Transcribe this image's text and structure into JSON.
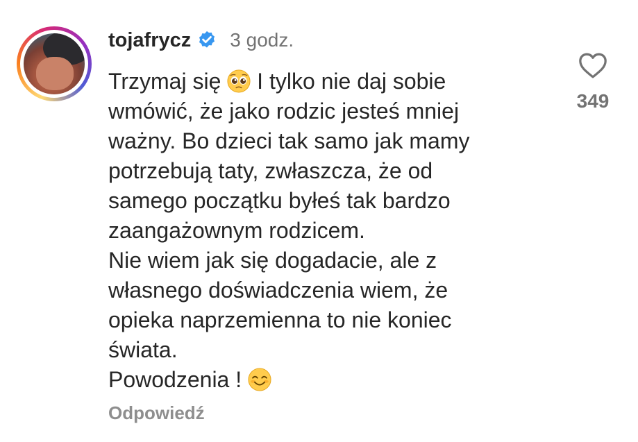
{
  "comment": {
    "username": "tojafrycz",
    "verified_icon": "verified-badge-icon",
    "timestamp": "3 godz.",
    "lines": [
      {
        "before": "Trzymaj się ",
        "emoji": "pleading-face",
        "after": " I tylko nie daj sobie"
      },
      {
        "text": "wmówić, że jako rodzic jesteś mniej"
      },
      {
        "text": "ważny. Bo dzieci tak samo jak mamy"
      },
      {
        "text": "potrzebują  taty, zwłaszcza, że od"
      },
      {
        "text": "samego początku byłeś tak bardzo"
      },
      {
        "text": "zaangażownym rodzicem."
      },
      {
        "text": "Nie wiem jak się dogadacie, ale z"
      },
      {
        "text": "własnego doświadczenia wiem, że"
      },
      {
        "text": "opieka naprzemienna to nie koniec"
      },
      {
        "text": "świata."
      },
      {
        "before": "Powodzenia ! ",
        "emoji": "smiling-face-with-smiling-eyes",
        "after": ""
      }
    ],
    "reply_label": "Odpowiedź",
    "like_icon": "heart-outline-icon",
    "like_count": "349"
  },
  "colors": {
    "verified_blue": "#3897f0",
    "secondary_text": "#737373",
    "primary_text": "#262626"
  }
}
